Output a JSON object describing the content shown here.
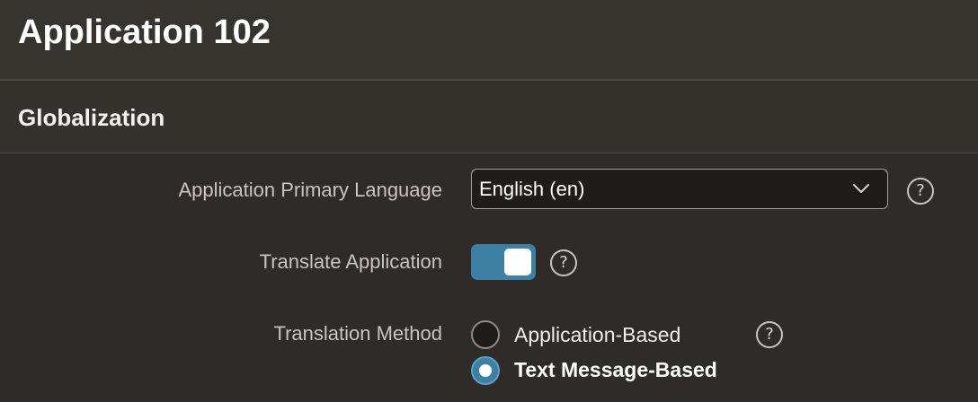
{
  "app": {
    "title": "Application 102"
  },
  "region": {
    "title": "Globalization"
  },
  "fields": {
    "primary_language": {
      "label": "Application Primary Language",
      "value": "English (en)",
      "help": "?"
    },
    "translate_application": {
      "label": "Translate Application",
      "enabled": true,
      "help": "?"
    },
    "translation_method": {
      "label": "Translation Method",
      "options": [
        {
          "label": "Application-Based",
          "selected": false
        },
        {
          "label": "Text Message-Based",
          "selected": true
        }
      ],
      "help": "?"
    }
  },
  "colors": {
    "accent": "#3e7fa4",
    "background": "#322e2b"
  },
  "icons": {
    "select_chevron": "chevron-down-icon",
    "help": "help-icon"
  }
}
